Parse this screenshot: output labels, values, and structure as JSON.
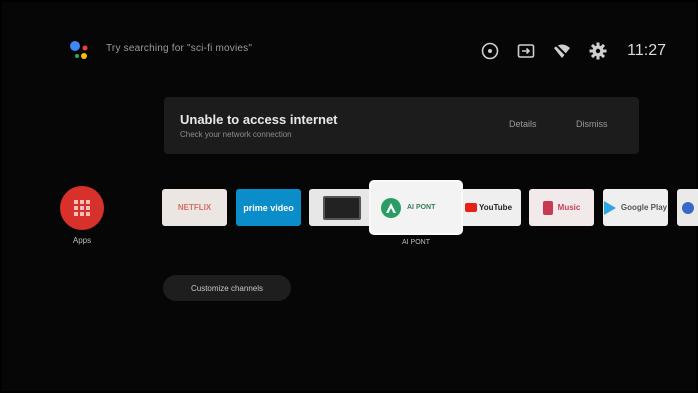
{
  "top_bar": {
    "search_hint": "Try searching for \"sci-fi movies\"",
    "clock": "11:27",
    "icons": [
      "assistant-icon",
      "input-source-icon",
      "tv-input-icon",
      "network-icon",
      "settings-icon"
    ]
  },
  "notification": {
    "title": "Unable to access internet",
    "subtitle": "Check your network connection",
    "details_label": "Details",
    "dismiss_label": "Dismiss"
  },
  "apps": {
    "apps_label": "Apps",
    "tiles": [
      {
        "name": "netflix",
        "label": "NETFLIX"
      },
      {
        "name": "prime-video",
        "label": "prime video"
      },
      {
        "name": "tv",
        "label": ""
      },
      {
        "name": "ai-pont",
        "label": "AI PONT",
        "focused_label": "AI PONT"
      },
      {
        "name": "youtube",
        "label": "YouTube"
      },
      {
        "name": "music",
        "label": "Music"
      },
      {
        "name": "play-store",
        "label": "Google Play"
      }
    ]
  },
  "customize_label": "Customize channels",
  "colors": {
    "background": "#060606",
    "apps_button": "#d8312c",
    "notification_card": "#1c1c1c"
  }
}
